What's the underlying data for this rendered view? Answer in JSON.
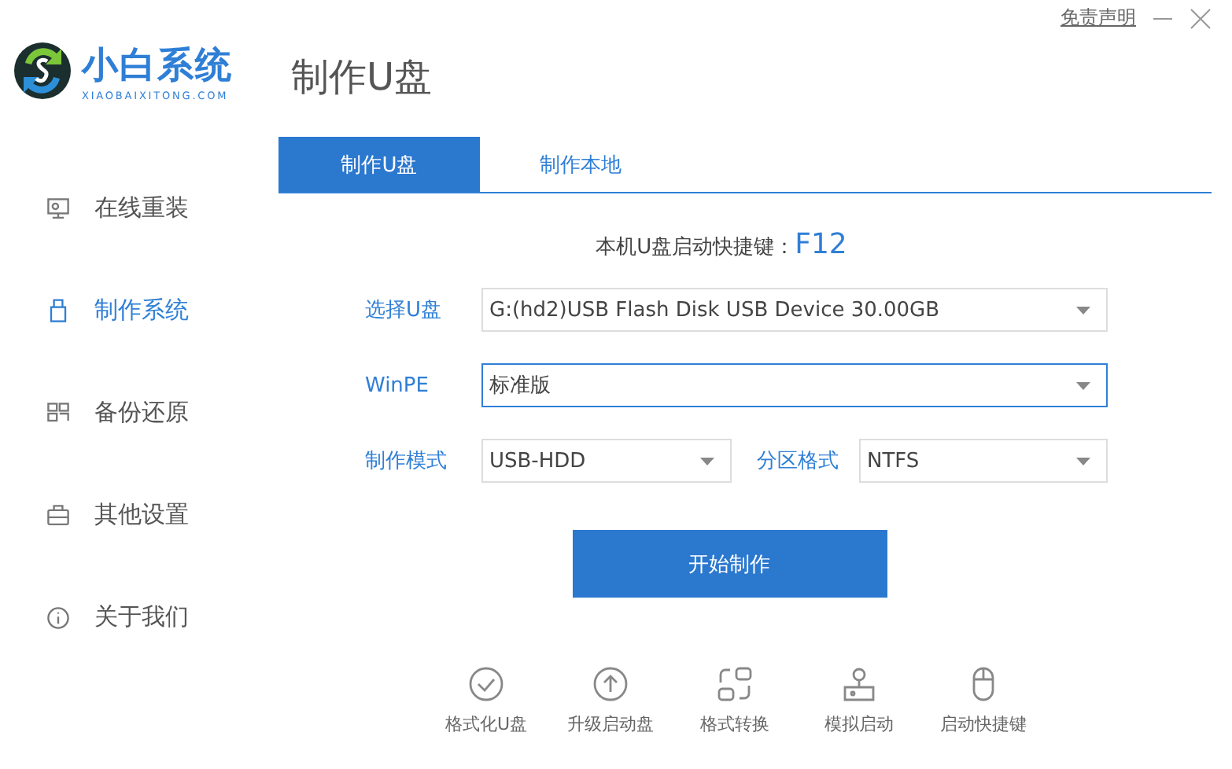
{
  "logo": {
    "name": "小白系统",
    "domain": "XIAOBAIXITONG.COM"
  },
  "header": {
    "title": "制作U盘",
    "disclaimer": "免责声明"
  },
  "sidebar": {
    "items": [
      {
        "kind": "monitor",
        "label": "在线重装",
        "selected": false
      },
      {
        "kind": "usb",
        "label": "制作系统",
        "selected": true
      },
      {
        "kind": "grid",
        "label": "备份还原",
        "selected": false
      },
      {
        "kind": "case",
        "label": "其他设置",
        "selected": false
      },
      {
        "kind": "info",
        "label": "关于我们",
        "selected": false
      }
    ]
  },
  "tabs": [
    {
      "label": "制作U盘",
      "selected": true
    },
    {
      "label": "制作本地",
      "selected": false
    }
  ],
  "hotkey": {
    "label": "本机U盘启动快捷键：",
    "key": "F12"
  },
  "fields": [
    {
      "label": "选择U盘",
      "value": "G:(hd2)USB Flash Disk USB Device 30.00GB",
      "focused": false
    },
    {
      "label": "WinPE",
      "value": "标准版",
      "focused": true
    }
  ],
  "mode": {
    "label": "制作模式",
    "value": "USB-HDD"
  },
  "partition": {
    "label": "分区格式",
    "value": "NTFS"
  },
  "start_button": "开始制作",
  "tools": [
    {
      "kind": "check",
      "label": "格式化U盘"
    },
    {
      "kind": "up",
      "label": "升级启动盘"
    },
    {
      "kind": "convert",
      "label": "格式转换"
    },
    {
      "kind": "stamp",
      "label": "模拟启动"
    },
    {
      "kind": "mouse",
      "label": "启动快捷键"
    }
  ]
}
